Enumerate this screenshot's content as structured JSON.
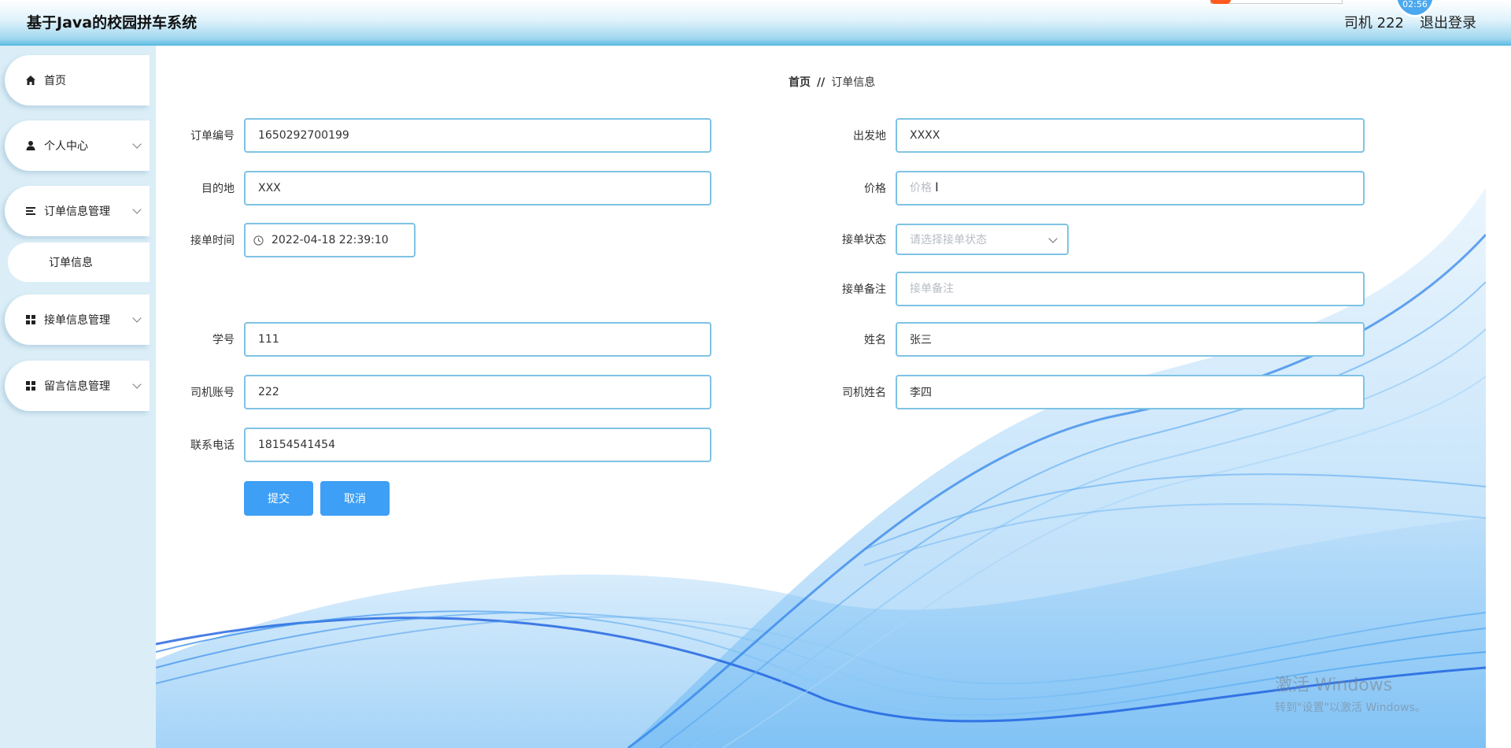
{
  "header": {
    "title": "基于Java的校园拼车系统",
    "user_label": "司机 222",
    "logout_label": "退出登录",
    "float_badge": "02:56"
  },
  "sidebar": {
    "items": [
      {
        "label": "首页",
        "icon": "home-icon"
      },
      {
        "label": "个人中心",
        "icon": "user-icon"
      },
      {
        "label": "订单信息管理",
        "icon": "list-icon"
      },
      {
        "label": "订单信息"
      },
      {
        "label": "接单信息管理",
        "icon": "grid-icon"
      },
      {
        "label": "留言信息管理",
        "icon": "grid-icon"
      }
    ]
  },
  "breadcrumb": {
    "home": "首页",
    "separator": "//",
    "current": "订单信息"
  },
  "form": {
    "order_no": {
      "label": "订单编号",
      "value": "1650292700199"
    },
    "departure": {
      "label": "出发地",
      "value": "XXXX"
    },
    "destination": {
      "label": "目的地",
      "value": "XXX"
    },
    "price": {
      "label": "价格",
      "placeholder": "价格"
    },
    "accept_time": {
      "label": "接单时间",
      "value": "2022-04-18 22:39:10"
    },
    "accept_status": {
      "label": "接单状态",
      "placeholder": "请选择接单状态"
    },
    "accept_note": {
      "label": "接单备注",
      "placeholder": "接单备注"
    },
    "student_id": {
      "label": "学号",
      "value": "111"
    },
    "name": {
      "label": "姓名",
      "value": "张三"
    },
    "driver_account": {
      "label": "司机账号",
      "value": "222"
    },
    "driver_name": {
      "label": "司机姓名",
      "value": "李四"
    },
    "phone": {
      "label": "联系电话",
      "value": "18154541454"
    },
    "submit_label": "提交",
    "cancel_label": "取消"
  },
  "watermark": {
    "line1": "激活 Windows",
    "line2": "转到\"设置\"以激活 Windows。"
  },
  "colors": {
    "accent": "#3d9ff5",
    "input_border": "#7fc3e4",
    "sidebar_bg": "#dbeef7",
    "header_blue": "#57b9e2"
  }
}
